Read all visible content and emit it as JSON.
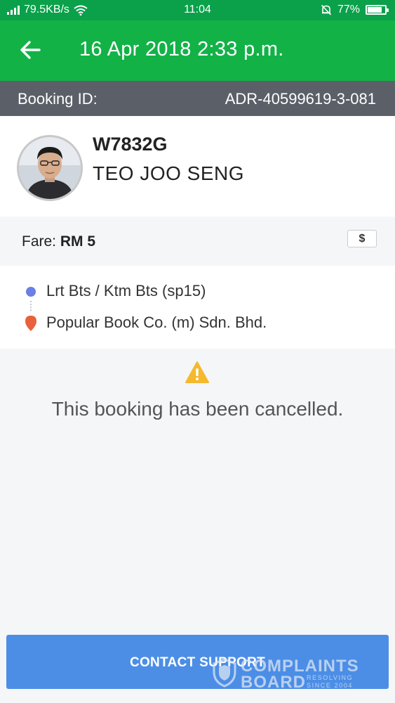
{
  "status_bar": {
    "network_speed": "79.5KB/s",
    "time": "11:04",
    "battery": "77%"
  },
  "header": {
    "title": "16 Apr 2018 2:33 p.m."
  },
  "booking": {
    "id_label": "Booking ID:",
    "id_value": "ADR-40599619-3-081"
  },
  "driver": {
    "plate": "W7832G",
    "name": "TEO JOO SENG"
  },
  "fare": {
    "label": "Fare:",
    "amount": "RM 5",
    "payment_icon": "$"
  },
  "route": {
    "pickup": "Lrt Bts / Ktm Bts (sp15)",
    "dropoff": "Popular Book Co. (m) Sdn. Bhd."
  },
  "notice": {
    "message": "This booking has been cancelled."
  },
  "actions": {
    "contact_support": "CONTACT SUPPORT"
  },
  "watermark": {
    "line1": "COMPLAINTS",
    "line2": "BOARD",
    "tag1": "RESOLVING",
    "tag2": "SINCE 2004"
  },
  "colors": {
    "status_bar": "#0aa14a",
    "app_bar": "#12b247",
    "booking_bar": "#5b6068",
    "pickup": "#6b7fe6",
    "dropoff": "#e8603c",
    "warning": "#f5b82e",
    "support_button": "#4c8ee6"
  }
}
